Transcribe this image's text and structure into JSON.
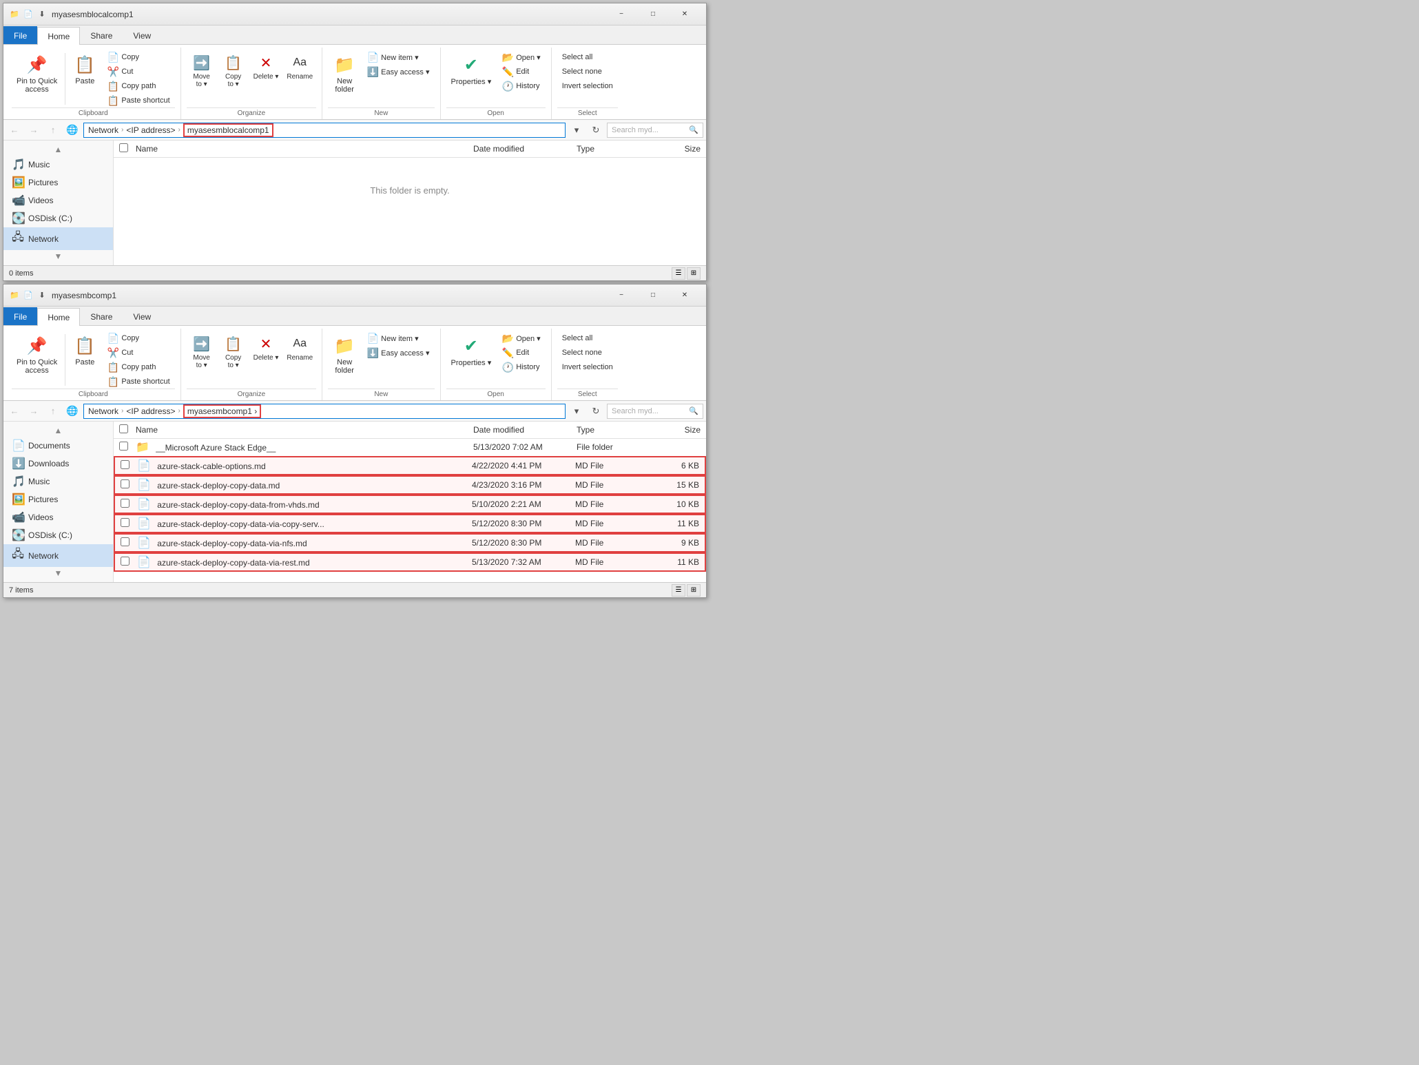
{
  "windows": [
    {
      "id": "window1",
      "title": "myasesmblocalcomp1",
      "title_prefix": "myasesmblocalcomp1",
      "address": {
        "parts": [
          "Network",
          "<IP address>",
          "myasesmblocalcomp1"
        ],
        "highlighted": true
      },
      "search_placeholder": "Search myd...",
      "sidebar_items": [
        {
          "label": "Music",
          "icon": "🎵"
        },
        {
          "label": "Pictures",
          "icon": "🖼️"
        },
        {
          "label": "Videos",
          "icon": "📹"
        },
        {
          "label": "OSDisk (C:)",
          "icon": "💽"
        },
        {
          "label": "Network",
          "icon": "🖧",
          "active": true
        }
      ],
      "files": [],
      "empty_message": "This folder is empty.",
      "status": "0 items",
      "columns": [
        "Name",
        "Date modified",
        "Type",
        "Size"
      ]
    },
    {
      "id": "window2",
      "title": "myasesmbcomp1",
      "title_prefix": "myasesmbcomp1",
      "address": {
        "parts": [
          "Network",
          "<IP address>",
          "myasesmbcomp1"
        ],
        "highlighted": true,
        "trailing": true
      },
      "search_placeholder": "Search myd...",
      "sidebar_items": [
        {
          "label": "Documents",
          "icon": "📄"
        },
        {
          "label": "Downloads",
          "icon": "⬇️"
        },
        {
          "label": "Music",
          "icon": "🎵"
        },
        {
          "label": "Pictures",
          "icon": "🖼️"
        },
        {
          "label": "Videos",
          "icon": "📹"
        },
        {
          "label": "OSDisk (C:)",
          "icon": "💽"
        },
        {
          "label": "Network",
          "icon": "🖧",
          "active": true
        }
      ],
      "files": [
        {
          "name": "__Microsoft Azure Stack Edge__",
          "date": "5/13/2020 7:02 AM",
          "type": "File folder",
          "size": "",
          "icon": "📁",
          "highlighted": false
        },
        {
          "name": "azure-stack-cable-options.md",
          "date": "4/22/2020 4:41 PM",
          "type": "MD File",
          "size": "6 KB",
          "icon": "📄",
          "highlighted": true
        },
        {
          "name": "azure-stack-deploy-copy-data.md",
          "date": "4/23/2020 3:16 PM",
          "type": "MD File",
          "size": "15 KB",
          "icon": "📄",
          "highlighted": true
        },
        {
          "name": "azure-stack-deploy-copy-data-from-vhds.md",
          "date": "5/10/2020 2:21 AM",
          "type": "MD File",
          "size": "10 KB",
          "icon": "📄",
          "highlighted": true
        },
        {
          "name": "azure-stack-deploy-copy-data-via-copy-serv...",
          "date": "5/12/2020 8:30 PM",
          "type": "MD File",
          "size": "11 KB",
          "icon": "📄",
          "highlighted": true
        },
        {
          "name": "azure-stack-deploy-copy-data-via-nfs.md",
          "date": "5/12/2020 8:30 PM",
          "type": "MD File",
          "size": "9 KB",
          "icon": "📄",
          "highlighted": true
        },
        {
          "name": "azure-stack-deploy-copy-data-via-rest.md",
          "date": "5/13/2020 7:32 AM",
          "type": "MD File",
          "size": "11 KB",
          "icon": "📄",
          "highlighted": true
        }
      ],
      "status": "7 items",
      "columns": [
        "Name",
        "Date modified",
        "Type",
        "Size"
      ]
    }
  ],
  "ribbon": {
    "clipboard_label": "Clipboard",
    "organize_label": "Organize",
    "new_label": "New",
    "open_label": "Open",
    "select_label": "Select",
    "buttons": {
      "pin_to_quick": "Pin to Quick\naccess",
      "copy": "Copy",
      "paste": "Paste",
      "cut": "Cut",
      "copy_path": "Copy path",
      "paste_shortcut": "Paste shortcut",
      "move_to": "Move\nto",
      "copy_to": "Copy\nto",
      "delete": "Delete",
      "rename": "Rename",
      "new_folder": "New\nfolder",
      "new_item": "New item",
      "easy_access": "Easy access",
      "properties": "Properties",
      "open": "Open",
      "edit": "Edit",
      "history": "History",
      "select_all": "Select all",
      "select_none": "Select none",
      "invert_selection": "Invert selection"
    }
  },
  "tabs": [
    "File",
    "Home",
    "Share",
    "View"
  ],
  "active_tab": "Home"
}
